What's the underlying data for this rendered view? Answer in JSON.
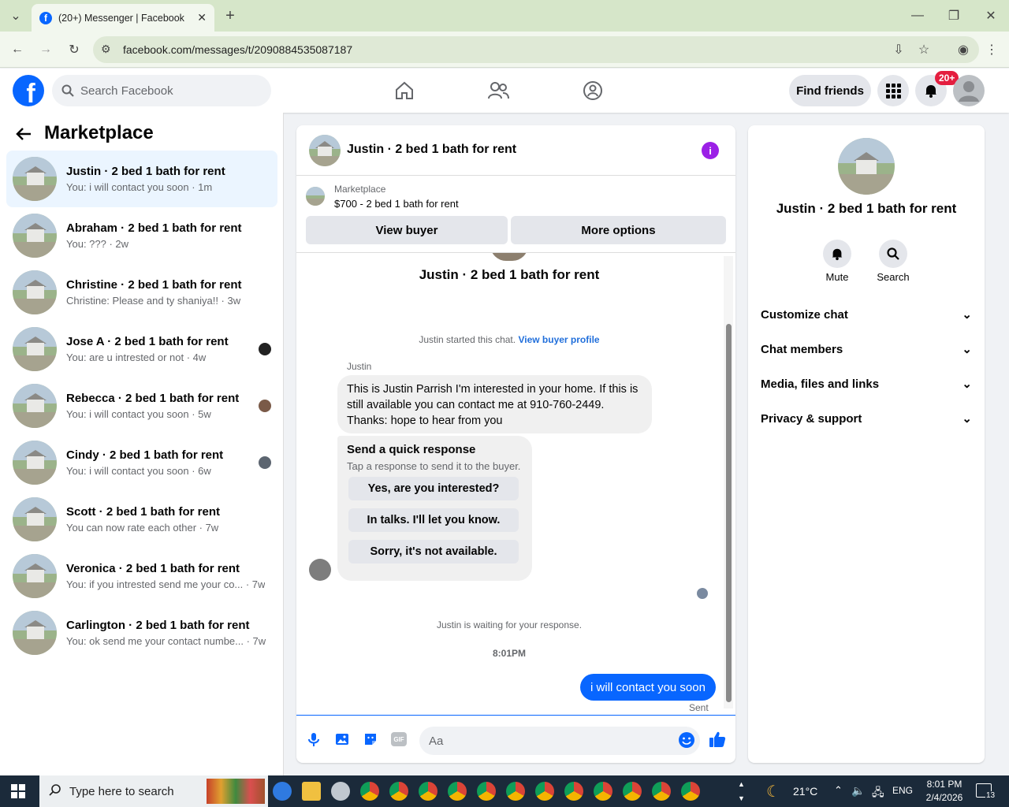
{
  "browser": {
    "tab_title": "(20+) Messenger | Facebook",
    "url": "facebook.com/messages/t/2090884535087187"
  },
  "header": {
    "search_placeholder": "Search Facebook",
    "find_friends": "Find friends",
    "notif_badge": "20+"
  },
  "sidebar": {
    "title": "Marketplace",
    "conversations": [
      {
        "name": "Justin · 2 bed 1 bath for rent",
        "preview": "You: i will contact you soon · 1m",
        "active": true
      },
      {
        "name": "Abraham · 2 bed 1 bath for rent",
        "preview": "You: ??? · 2w"
      },
      {
        "name": "Christine · 2 bed 1 bath for rent",
        "preview": "Christine: Please and ty shaniya!! · 3w"
      },
      {
        "name": "Jose A · 2 bed 1 bath for rent",
        "preview": "You: are u intrested or not · 4w"
      },
      {
        "name": "Rebecca · 2 bed 1 bath for rent",
        "preview": "You: i will contact you soon · 5w"
      },
      {
        "name": "Cindy · 2 bed 1 bath for rent",
        "preview": "You: i will contact you soon · 6w"
      },
      {
        "name": "Scott · 2 bed 1 bath for rent",
        "preview": "You can now rate each other · 7w"
      },
      {
        "name": "Veronica · 2 bed 1 bath for rent",
        "preview": "You: if you intrested send me your co... · 7w"
      },
      {
        "name": "Carlington · 2 bed 1 bath for rent",
        "preview": "You: ok send me your contact numbe... · 7w"
      }
    ]
  },
  "chat": {
    "title": "Justin · 2 bed 1 bath for rent",
    "listing_source": "Marketplace",
    "listing_title": "$700 - 2 bed 1 bath for rent",
    "view_buyer": "View buyer",
    "more_options": "More options",
    "thread_title": "Justin · 2 bed 1 bath for rent",
    "started_text": "Justin started this chat.",
    "view_buyer_profile": "View buyer profile",
    "sender": "Justin",
    "message": "This is Justin Parrish I'm interested in your home. If this is still available you can contact me at 910-760-2449. Thanks: hope to hear from you",
    "quick_title": "Send a quick response",
    "quick_sub": "Tap a response to send it to the buyer.",
    "quick_replies": [
      "Yes, are you interested?",
      "In talks. I'll let you know.",
      "Sorry, it's not available."
    ],
    "waiting": "Justin is waiting for your response.",
    "time": "8:01PM",
    "my_message": "i will contact you soon",
    "status": "Sent",
    "composer_placeholder": "Aa"
  },
  "details": {
    "name": "Justin · 2 bed 1 bath for rent",
    "mute": "Mute",
    "search": "Search",
    "sections": [
      "Customize chat",
      "Chat members",
      "Media, files and links",
      "Privacy & support"
    ]
  },
  "taskbar": {
    "search_placeholder": "Type here to search",
    "weather": "21°C",
    "lang": "ENG",
    "time": "8:01 PM",
    "date": "2/4/2026",
    "notifications": "13"
  }
}
